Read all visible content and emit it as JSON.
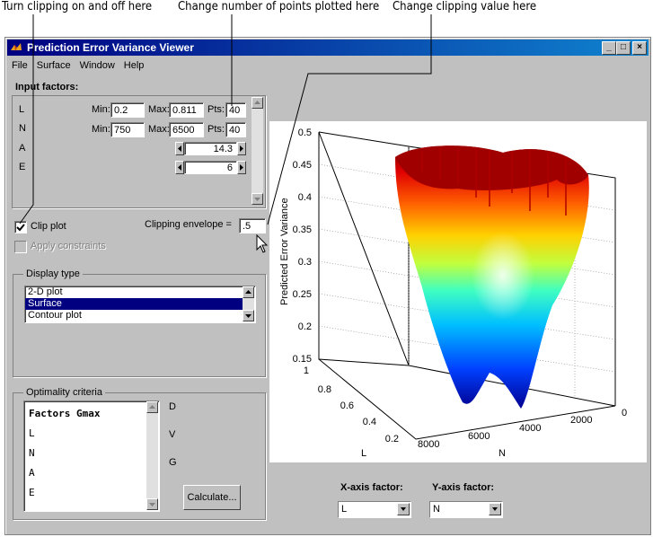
{
  "callouts": {
    "clip": "Turn clipping on and off here",
    "points": "Change number of points plotted here",
    "clipval": "Change clipping value here"
  },
  "window": {
    "title": "Prediction Error Variance Viewer",
    "controls": [
      "_",
      "□",
      "×"
    ]
  },
  "menu": [
    "File",
    "Surface",
    "Window",
    "Help"
  ],
  "input_factors": {
    "heading": "Input factors:",
    "rows": [
      {
        "name": "L",
        "min_label": "Min:",
        "min": "0.2",
        "max_label": "Max:",
        "max": "0.811",
        "pts_label": "Pts:",
        "pts": "40"
      },
      {
        "name": "N",
        "min_label": "Min:",
        "min": "750",
        "max_label": "Max:",
        "max": "6500",
        "pts_label": "Pts:",
        "pts": "40"
      },
      {
        "name": "A",
        "value": "14.3"
      },
      {
        "name": "E",
        "value": "6"
      }
    ]
  },
  "clip": {
    "label": "Clip plot",
    "checked": true,
    "envelope_label": "Clipping envelope =",
    "envelope_value": ".5",
    "constraints_label": "Apply constraints"
  },
  "display_type": {
    "legend": "Display type",
    "options": [
      "2-D plot",
      "Surface",
      "Contour plot"
    ],
    "selected": "Surface"
  },
  "optimality": {
    "legend": "Optimality criteria",
    "list": [
      "Factors Gmax",
      "L",
      "N",
      "A",
      "E"
    ],
    "side_labels": [
      "D",
      "V",
      "G"
    ],
    "calculate": "Calculate..."
  },
  "axes_select": {
    "x_label": "X-axis factor:",
    "x_value": "L",
    "y_label": "Y-axis factor:",
    "y_value": "N"
  },
  "plot": {
    "zlabel": "Predicted Error Variance",
    "xlabel": "L",
    "ylabel": "N",
    "z_ticks": [
      "0.5",
      "0.45",
      "0.4",
      "0.35",
      "0.3",
      "0.25",
      "0.2",
      "0.15"
    ],
    "l_ticks": [
      "1",
      "0.8",
      "0.6",
      "0.4",
      "0.2"
    ],
    "n_ticks": [
      "8000",
      "6000",
      "4000",
      "2000",
      "0"
    ]
  },
  "colors": {
    "titlebar": "#000080",
    "face": "#c0c0c0",
    "selection": "#000080"
  }
}
